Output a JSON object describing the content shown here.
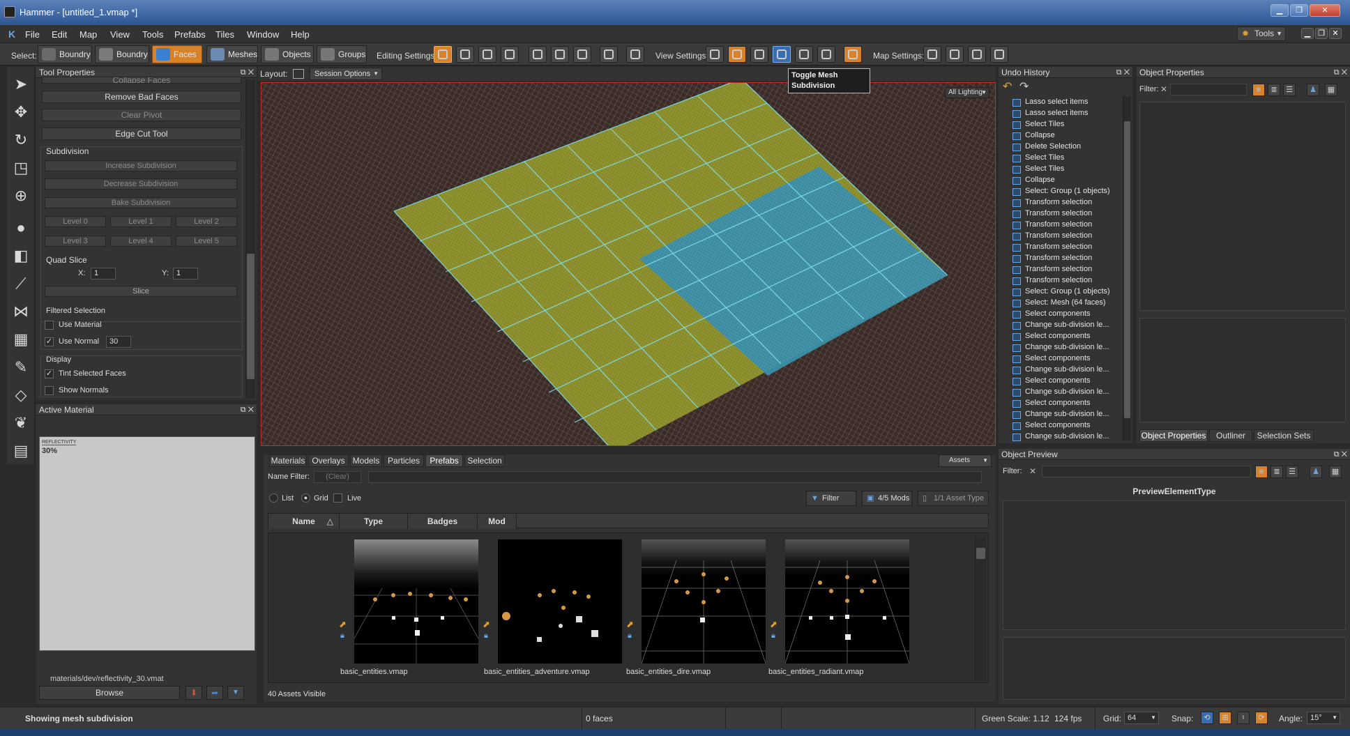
{
  "window": {
    "title": "Hammer - [untitled_1.vmap *]"
  },
  "menu": {
    "items": [
      "File",
      "Edit",
      "Map",
      "View",
      "Tools",
      "Prefabs",
      "Tiles",
      "Window",
      "Help"
    ],
    "right_label": "Tools"
  },
  "toolbar": {
    "select_label": "Select:",
    "modes": [
      {
        "label": "Boundry"
      },
      {
        "label": "Boundry"
      },
      {
        "label": "Faces"
      },
      {
        "label": "Meshes"
      },
      {
        "label": "Objects"
      },
      {
        "label": "Groups"
      }
    ],
    "editing_label": "Editing Settings:",
    "view_label": "View Settings:",
    "map_label": "Map Settings:"
  },
  "tool_properties": {
    "title": "Tool Properties",
    "partial_top": "Collapse Faces",
    "remove_bad_faces": "Remove Bad Faces",
    "clear_pivot": "Clear Pivot",
    "edge_cut_tool": "Edge Cut Tool",
    "subdivision": {
      "label": "Subdivision",
      "increase": "Increase Subdivision",
      "decrease": "Decrease Subdivision",
      "bake": "Bake Subdivision",
      "levels": [
        "Level 0",
        "Level 1",
        "Level 2",
        "Level 3",
        "Level 4",
        "Level 5"
      ]
    },
    "quad_slice": {
      "label": "Quad Slice",
      "x_label": "X:",
      "x_value": "1",
      "y_label": "Y:",
      "y_value": "1",
      "slice": "Slice"
    },
    "filtered_selection": {
      "label": "Filtered Selection",
      "use_material": "Use Material",
      "use_normal": "Use Normal",
      "normal_value": "30"
    },
    "display": {
      "label": "Display",
      "tint": "Tint Selected Faces",
      "show_normals": "Show Normals"
    }
  },
  "active_material": {
    "title": "Active Material",
    "preview_caption": "REFLECTIVITY",
    "preview_value": "30%",
    "path": "materials/dev/reflectivity_30.vmat",
    "browse": "Browse"
  },
  "viewport": {
    "layout_label": "Layout:",
    "session_options": "Session Options",
    "lighting": "All Lighting"
  },
  "tooltip": {
    "line1": "Toggle Mesh",
    "line2": "Subdivision"
  },
  "assets": {
    "tabs": [
      "Materials",
      "Overlays",
      "Models",
      "Particles",
      "Prefabs",
      "Selection"
    ],
    "active_tab": "Prefabs",
    "assets_button": "Assets",
    "name_filter_label": "Name Filter:",
    "name_filter_placeholder": "(Clear)",
    "view_list": "List",
    "view_grid": "Grid",
    "live": "Live",
    "filter": "Filter",
    "mods": "4/5 Mods",
    "asset_type": "1/1 Asset Type",
    "columns": [
      "Name",
      "Type",
      "Badges",
      "Mod"
    ],
    "items": [
      "basic_entities.vmap",
      "basic_entities_adventure.vmap",
      "basic_entities_dire.vmap",
      "basic_entities_radiant.vmap"
    ],
    "count": "40 Assets Visible"
  },
  "undo_history": {
    "title": "Undo History",
    "items": [
      "Lasso select items",
      "Lasso select items",
      "Select Tiles",
      "Collapse",
      "Delete Selection",
      "Select Tiles",
      "Select Tiles",
      "Collapse",
      "Select: Group (1 objects)",
      "Transform selection",
      "Transform selection",
      "Transform selection",
      "Transform selection",
      "Transform selection",
      "Transform selection",
      "Transform selection",
      "Transform selection",
      "Select: Group (1 objects)",
      "Select: Mesh (64 faces)",
      "Select components",
      "Change sub-division le...",
      "Select components",
      "Change sub-division le...",
      "Select components",
      "Change sub-division le...",
      "Select components",
      "Change sub-division le...",
      "Select components",
      "Change sub-division le...",
      "Select components",
      "Change sub-division le..."
    ]
  },
  "object_properties": {
    "title": "Object Properties",
    "filter_label": "Filter:",
    "tabs": [
      "Object Properties",
      "Outliner",
      "Selection Sets"
    ]
  },
  "object_preview": {
    "title": "Object Preview",
    "filter_label": "Filter:",
    "element_type": "PreviewElementType"
  },
  "status": {
    "message": "Showing mesh subdivision",
    "faces": "0 faces",
    "green_scale": "Green Scale: 1.12",
    "fps": "124 fps",
    "grid_label": "Grid:",
    "grid_value": "64",
    "snap_label": "Snap:",
    "angle_label": "Angle:",
    "angle_value": "15°"
  },
  "colors": {
    "accent": "#d8822a",
    "selection_red": "#dd2222",
    "yellow_face": "#8a8a20",
    "blue_face": "#3a8aa0",
    "wire": "#7fe0f0"
  }
}
